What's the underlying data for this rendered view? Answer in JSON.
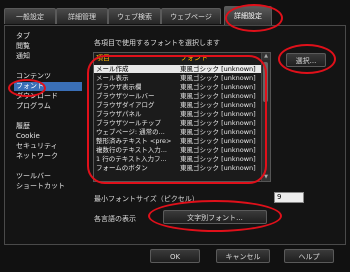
{
  "tabs": [
    {
      "label": "一般設定",
      "active": false
    },
    {
      "label": "詳細管理",
      "active": false
    },
    {
      "label": "ウェブ検索",
      "active": false
    },
    {
      "label": "ウェブページ",
      "active": false
    },
    {
      "label": "詳細設定",
      "active": true
    }
  ],
  "sidebar": {
    "items": [
      {
        "label": "タブ"
      },
      {
        "label": "閲覧"
      },
      {
        "label": "通知"
      },
      {
        "label": "コンテンツ"
      },
      {
        "label": "フォント",
        "selected": true
      },
      {
        "label": "ダウンロード"
      },
      {
        "label": "プログラム"
      },
      {
        "label": "履歴"
      },
      {
        "label": "Cookie"
      },
      {
        "label": "セキュリティ"
      },
      {
        "label": "ネットワーク"
      },
      {
        "label": "ツールバー"
      },
      {
        "label": "ショートカット"
      }
    ]
  },
  "main": {
    "description": "各項目で使用するフォントを選択します",
    "columns": {
      "item": "項目",
      "font": "フォント"
    },
    "rows": [
      {
        "item": "メール作成",
        "font": "東風ゴシック [unknown]",
        "selected": true
      },
      {
        "item": "メール表示",
        "font": "東風ゴシック [unknown]"
      },
      {
        "item": "ブラウザ表示欄",
        "font": "東風ゴシック [unknown]"
      },
      {
        "item": "ブラウザツールバー",
        "font": "東風ゴシック [unknown]"
      },
      {
        "item": "ブラウザダイアログ",
        "font": "東風ゴシック [unknown]"
      },
      {
        "item": "ブラウザパネル",
        "font": "東風ゴシック [unknown]"
      },
      {
        "item": "ブラウザツールチップ",
        "font": "東風ゴシック [unknown]"
      },
      {
        "item": "ウェブページ: 通常の...",
        "font": "東風ゴシック [unknown]"
      },
      {
        "item": "整形済みテキスト <pre>",
        "font": "東風ゴシック [unknown]"
      },
      {
        "item": "複数行のテキスト入力...",
        "font": "東風ゴシック [unknown]"
      },
      {
        "item": "1 行のテキスト入力フ...",
        "font": "東風ゴシック [unknown]"
      },
      {
        "item": "フォームのボタン",
        "font": "東風ゴシック [unknown]"
      }
    ],
    "choose_button": "選択...",
    "min_font_label": "最小フォントサイズ（ピクセル）",
    "min_font_value": "9",
    "international_label": "各言語の表示",
    "international_button": "文字別フォント..."
  },
  "footer": {
    "ok": "OK",
    "cancel": "キャンセル",
    "help": "ヘルプ"
  },
  "colors": {
    "selection": "#3a6fb7",
    "header": "#ffb600",
    "highlight_oval": "#e0101a"
  }
}
